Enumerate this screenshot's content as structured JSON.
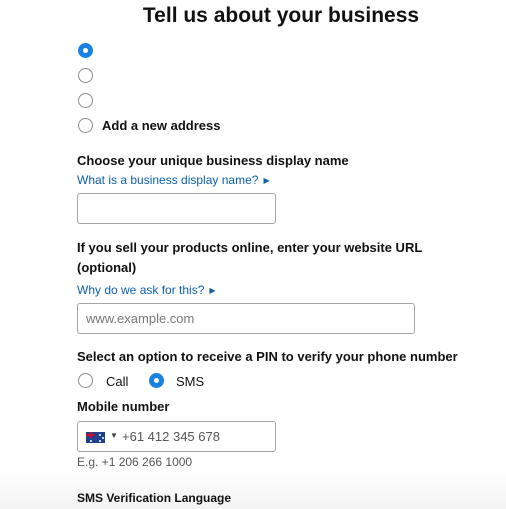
{
  "page": {
    "title": "Tell us about your business"
  },
  "address_options": {
    "options": [
      "",
      "",
      ""
    ],
    "add_new_label": "Add a new address",
    "selected_index": 0
  },
  "display_name": {
    "label": "Choose your unique business display name",
    "help_link": "What is a business display name?",
    "value": ""
  },
  "website": {
    "label_line1": "If you sell your products online, enter your website URL",
    "label_line2": "(optional)",
    "help_link": "Why do we ask for this?",
    "placeholder": "www.example.com"
  },
  "pin": {
    "label": "Select an option to receive a PIN to verify your phone number",
    "options": [
      "Call",
      "SMS"
    ],
    "selected": "SMS"
  },
  "mobile": {
    "label": "Mobile number",
    "country": "Australia",
    "placeholder": "+61 412 345 678",
    "hint": "E.g. +1 206 266 1000"
  },
  "sms_language": {
    "label": "SMS Verification Language"
  },
  "colors": {
    "accent": "#1a82e2",
    "link": "#0b5fb0"
  }
}
